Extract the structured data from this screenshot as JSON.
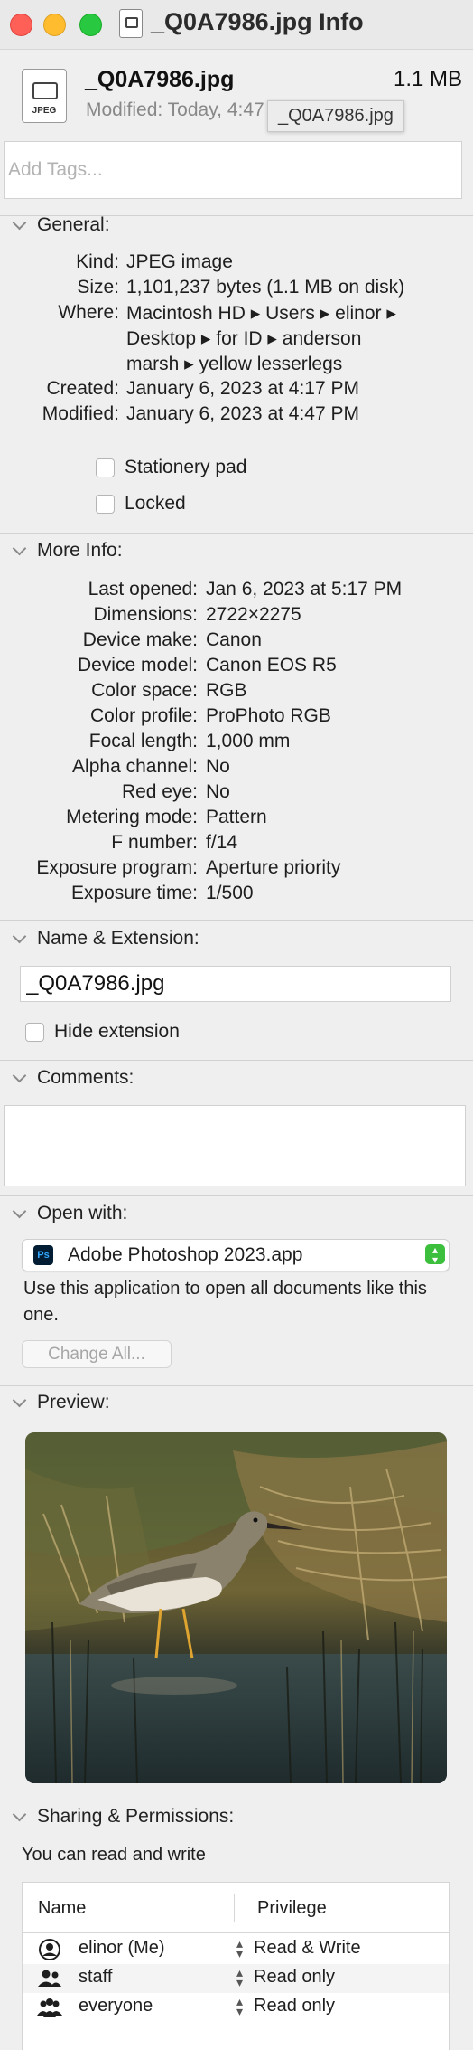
{
  "window": {
    "title": "_Q0A7986.jpg Info",
    "traffic_lights": [
      "close",
      "minimize",
      "zoom"
    ]
  },
  "header": {
    "file_icon_label": "JPEG",
    "file_name": "_Q0A7986.jpg",
    "file_size": "1.1 MB",
    "modified_line": "Modified: Today, 4:47 PM",
    "tooltip": "_Q0A7986.jpg"
  },
  "tags": {
    "placeholder": "Add Tags..."
  },
  "general": {
    "title": "General:",
    "rows": [
      {
        "key": "Kind:",
        "value": "JPEG image"
      },
      {
        "key": "Size:",
        "value": "1,101,237 bytes (1.1 MB on disk)"
      },
      {
        "key": "Where:",
        "value": "Macintosh HD ▸ Users ▸ elinor ▸"
      },
      {
        "key": "",
        "value": "Desktop ▸ for ID ▸ anderson"
      },
      {
        "key": "",
        "value": "marsh ▸ yellow lesserlegs"
      },
      {
        "key": "Created:",
        "value": "January 6, 2023 at 4:17 PM"
      },
      {
        "key": "Modified:",
        "value": "January 6, 2023 at 4:47 PM"
      }
    ],
    "stationery": "Stationery pad",
    "locked": "Locked"
  },
  "more_info": {
    "title": "More Info:",
    "rows": [
      {
        "key": "Last opened:",
        "value": "Jan 6, 2023 at 5:17 PM"
      },
      {
        "key": "Dimensions:",
        "value": "2722×2275"
      },
      {
        "key": "Device make:",
        "value": "Canon"
      },
      {
        "key": "Device model:",
        "value": "Canon EOS R5"
      },
      {
        "key": "Color space:",
        "value": "RGB"
      },
      {
        "key": "Color profile:",
        "value": "ProPhoto RGB"
      },
      {
        "key": "Focal length:",
        "value": "1,000 mm"
      },
      {
        "key": "Alpha channel:",
        "value": "No"
      },
      {
        "key": "Red eye:",
        "value": "No"
      },
      {
        "key": "Metering mode:",
        "value": "Pattern"
      },
      {
        "key": "F number:",
        "value": "f/14"
      },
      {
        "key": "Exposure program:",
        "value": "Aperture priority"
      },
      {
        "key": "Exposure time:",
        "value": "1/500"
      }
    ]
  },
  "name_extension": {
    "title": "Name & Extension:",
    "value": "_Q0A7986.jpg",
    "hide_extension": "Hide extension"
  },
  "comments": {
    "title": "Comments:"
  },
  "open_with": {
    "title": "Open with:",
    "app_icon": "Ps",
    "app": "Adobe Photoshop 2023.app",
    "description": "Use this application to open all documents like this one.",
    "change_all": "Change All..."
  },
  "preview": {
    "title": "Preview:"
  },
  "sharing": {
    "title": "Sharing & Permissions:",
    "description": "You can read and write",
    "headers": {
      "name": "Name",
      "privilege": "Privilege"
    },
    "rows": [
      {
        "name": "elinor (Me)",
        "privilege": "Read & Write",
        "icon": "user-icon"
      },
      {
        "name": "staff",
        "privilege": "Read only",
        "icon": "group-icon"
      },
      {
        "name": "everyone",
        "privilege": "Read only",
        "icon": "everyone-icon"
      }
    ]
  },
  "colors": {
    "background": "#efefef",
    "close": "#fe5f57",
    "minimize": "#febc2e",
    "zoom": "#28c840",
    "popup_accent": "#3cbf3c"
  }
}
